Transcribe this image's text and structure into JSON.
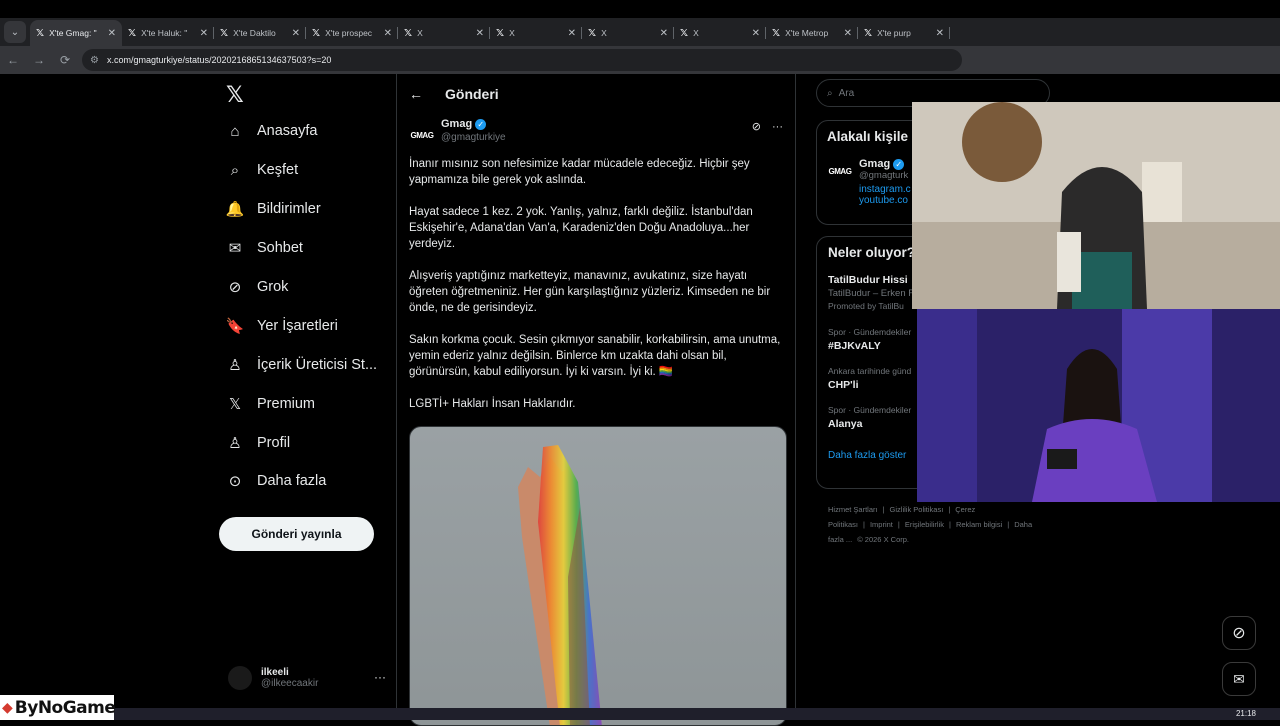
{
  "browser": {
    "tabs": [
      {
        "label": "X'te Gmag: \"",
        "active": true
      },
      {
        "label": "X'te Haluk: \"",
        "active": false
      },
      {
        "label": "X'te Daktilo",
        "active": false
      },
      {
        "label": "X'te prospec",
        "active": false
      },
      {
        "label": "X",
        "active": false
      },
      {
        "label": "X",
        "active": false
      },
      {
        "label": "X",
        "active": false
      },
      {
        "label": "X",
        "active": false
      },
      {
        "label": "X'te Metrop",
        "active": false
      },
      {
        "label": "X'te purp",
        "active": false
      }
    ],
    "url": "x.com/gmagturkiye/status/2020216865134637503?s=20"
  },
  "nav": {
    "items": [
      {
        "label": "Anasayfa",
        "icon": "home-icon"
      },
      {
        "label": "Keşfet",
        "icon": "search-icon"
      },
      {
        "label": "Bildirimler",
        "icon": "bell-icon"
      },
      {
        "label": "Sohbet",
        "icon": "mail-icon"
      },
      {
        "label": "Grok",
        "icon": "grok-icon"
      },
      {
        "label": "Yer İşaretleri",
        "icon": "bookmark-icon"
      },
      {
        "label": "İçerik Üreticisi St...",
        "icon": "creator-icon"
      },
      {
        "label": "Premium",
        "icon": "x-icon"
      },
      {
        "label": "Profil",
        "icon": "person-icon"
      },
      {
        "label": "Daha fazla",
        "icon": "more-circle-icon"
      }
    ],
    "post_button": "Gönderi yayınla",
    "profile": {
      "name": "ilkeeli",
      "handle": "@ilkeecaakir"
    }
  },
  "main": {
    "header_title": "Gönderi",
    "tweet": {
      "avatar_text": "GMAG",
      "author_name": "Gmag",
      "author_handle": "@gmagturkiye",
      "paragraphs": [
        "İnanır mısınız son nefesimize kadar mücadele edeceğiz. Hiçbir şey yapmamıza bile gerek yok aslında.",
        "Hayat sadece 1 kez. 2 yok. Yanlış, yalnız, farklı değiliz. İstanbul'dan Eskişehir'e, Adana'dan Van'a, Karadeniz'den Doğu Anadoluya...her yerdeyiz.",
        "Alışveriş yaptığınız marketteyiz, manavınız, avukatınız, size hayatı öğreten öğretmeniniz. Her gün karşılaştığınız yüzleriz. Kimseden ne bir önde, ne de gerisindeyiz.",
        "Sakın korkma çocuk. Sesin çıkmıyor sanabilir, korkabilirsin, ama unutma, yemin ederiz yalnız değilsin. Binlerce km uzakta dahi olsan bil, görünürsün, kabul ediliyorsun. İyi ki varsın. İyi ki. 🏳️‍🌈",
        "LGBTİ+ Hakları İnsan Haklarıdır."
      ]
    }
  },
  "right": {
    "search_placeholder": "Ara",
    "related": {
      "title": "Alakalı kişile",
      "name": "Gmag",
      "handle": "@gmagturk",
      "link1": "instagram.c",
      "link2": "youtube.co"
    },
    "trends": {
      "title": "Neler oluyor?",
      "items": [
        {
          "category": "",
          "name": "TatilBudur Hissi",
          "sub": "TatilBudur – Erken R",
          "promo": "Promoted by TatilBu"
        },
        {
          "category": "Spor · Gündemdekiler",
          "name": "#BJKvALY"
        },
        {
          "category": "Ankara tarihinde günd",
          "name": "CHP'li"
        },
        {
          "category": "Spor · Gündemdekiler",
          "name": "Alanya"
        }
      ],
      "show_more": "Daha fazla göster"
    },
    "footer": [
      "Hizmet Şartları",
      "|",
      "Gizlilik Politikası",
      "|",
      "Çerez Politikası",
      "|",
      "Imprint",
      "|",
      "Erişilebilirlik",
      "|",
      "Reklam bilgisi",
      "|",
      "Daha fazla ...",
      "© 2026 X Corp."
    ]
  },
  "taskbar": {
    "clock": "21:18"
  },
  "watermark": "ByNoGame",
  "colors": {
    "accent": "#1d9bf0",
    "bg": "#000000",
    "text": "#e7e9ea",
    "muted": "#71767b"
  }
}
